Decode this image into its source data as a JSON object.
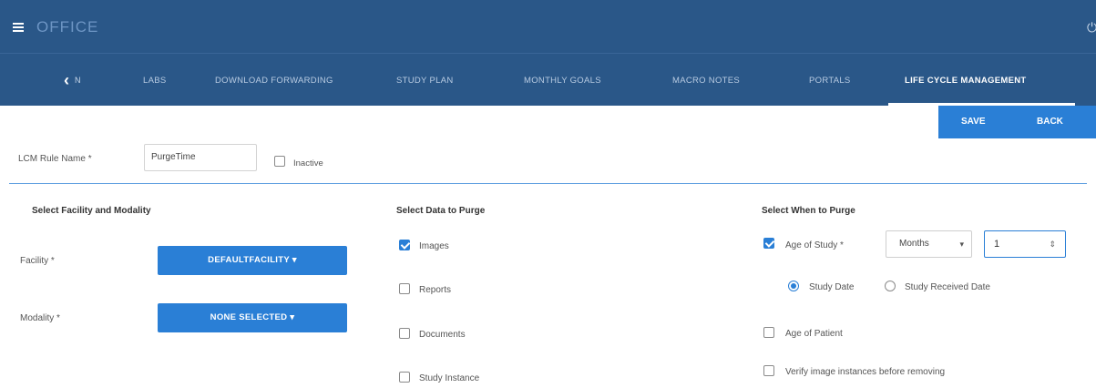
{
  "header": {
    "app_title": "OFFICE",
    "menu_icon": "hamburger-icon",
    "power_icon": "power-icon"
  },
  "tabs": {
    "back_label": "N",
    "items": [
      {
        "label": "LABS"
      },
      {
        "label": "DOWNLOAD FORWARDING"
      },
      {
        "label": "STUDY PLAN"
      },
      {
        "label": "MONTHLY GOALS"
      },
      {
        "label": "MACRO NOTES"
      },
      {
        "label": "PORTALS"
      },
      {
        "label": "LIFE CYCLE MANAGEMENT"
      }
    ],
    "active_index": 6
  },
  "actions": {
    "save_label": "SAVE",
    "back_label": "BACK"
  },
  "rule": {
    "name_label": "LCM Rule Name *",
    "name_value": "PurgeTime",
    "inactive_label": "Inactive",
    "inactive_checked": false
  },
  "facility_section": {
    "title": "Select Facility and Modality",
    "facility_label": "Facility *",
    "facility_value": "DEFAULTFACILITY ▾",
    "modality_label": "Modality *",
    "modality_value": "NONE SELECTED ▾"
  },
  "data_section": {
    "title": "Select Data to Purge",
    "options": [
      {
        "label": "Images",
        "checked": true
      },
      {
        "label": "Reports",
        "checked": false
      },
      {
        "label": "Documents",
        "checked": false
      },
      {
        "label": "Study Instance",
        "checked": false
      }
    ]
  },
  "when_section": {
    "title": "Select When to Purge",
    "age_of_study_label": "Age of Study *",
    "age_of_study_checked": true,
    "unit_value": "Months",
    "amount_value": "1",
    "radio_options": [
      {
        "label": "Study Date",
        "selected": true
      },
      {
        "label": "Study Received Date",
        "selected": false
      }
    ],
    "age_of_patient_label": "Age of Patient",
    "age_of_patient_checked": false,
    "verify_label": "Verify image instances before removing",
    "verify_checked": false
  },
  "colors": {
    "header_bg": "#2a5788",
    "accent": "#2a7fd6"
  }
}
